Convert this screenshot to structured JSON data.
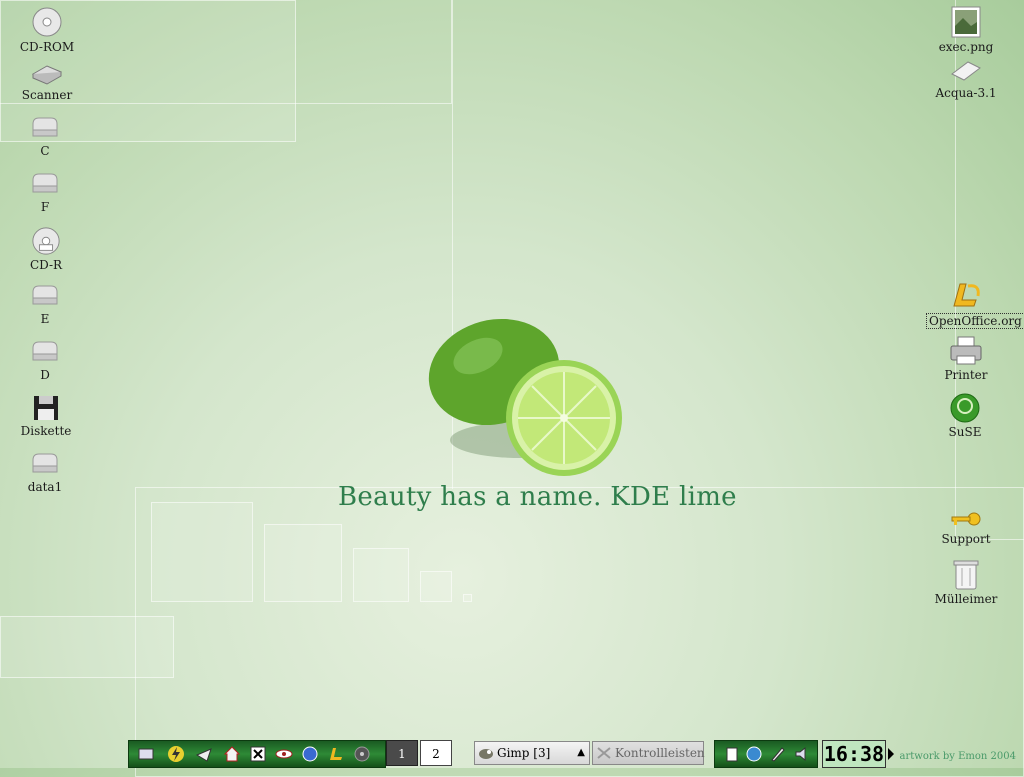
{
  "desktop": {
    "left_icons": [
      {
        "label": "CD-ROM",
        "icon": "cdrom-icon"
      },
      {
        "label": "Scanner",
        "icon": "scanner-icon"
      },
      {
        "label": "C",
        "icon": "harddrive-icon"
      },
      {
        "label": "F",
        "icon": "harddrive-icon"
      },
      {
        "label": "CD-R",
        "icon": "cdr-icon"
      },
      {
        "label": "E",
        "icon": "harddrive-icon"
      },
      {
        "label": "D",
        "icon": "harddrive-icon"
      },
      {
        "label": "Diskette",
        "icon": "floppy-icon"
      },
      {
        "label": "data1",
        "icon": "harddrive-icon"
      }
    ],
    "right_icons": [
      {
        "label": "exec.png",
        "icon": "image-file-icon"
      },
      {
        "label": "Acqua-3.1",
        "icon": "package-icon"
      },
      {
        "label": "OpenOffice.org",
        "icon": "openoffice-icon"
      },
      {
        "label": "Printer",
        "icon": "printer-icon"
      },
      {
        "label": "SuSE",
        "icon": "suse-icon"
      },
      {
        "label": "Support",
        "icon": "key-icon"
      },
      {
        "label": "Mülleimer",
        "icon": "trash-icon"
      }
    ],
    "slogan": "Beauty has a name. KDE lime",
    "credit": "artwork by Emon 2004"
  },
  "taskbar": {
    "launchers": [
      "kmenu-icon",
      "lightning-icon",
      "send-icon",
      "home-icon",
      "x-icon",
      "eye-icon",
      "globe-icon",
      "openoffice-icon",
      "disc-icon"
    ],
    "pager": [
      "1",
      "2"
    ],
    "tasks": [
      {
        "label": "Gimp [3]",
        "icon": "gimp-icon"
      },
      {
        "label": "Kontrollleisten",
        "icon": "tools-icon"
      }
    ],
    "tray": [
      "clipboard-icon",
      "network-icon",
      "pen-icon",
      "speaker-icon"
    ],
    "clock": "16:38"
  },
  "colors": {
    "slogan": "#2f7e4c",
    "taskbar_green": "#2e8a36"
  }
}
